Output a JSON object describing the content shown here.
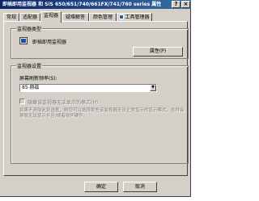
{
  "window": {
    "title": "即插即用监视器 和 SiS 650/651/740/661FX/741/760 series 属性",
    "help_label": "?",
    "close_label": "×"
  },
  "tabs": [
    {
      "label": "常规"
    },
    {
      "label": "适配器"
    },
    {
      "label": "监视器"
    },
    {
      "label": "疑难解答"
    },
    {
      "label": "颜色管理"
    },
    {
      "label": "工具管理器"
    }
  ],
  "monitor_type": {
    "group_label": "监视器类型",
    "name": "即插即用监视器",
    "properties_button": "属性(P)"
  },
  "monitor_settings": {
    "group_label": "监视器设置",
    "refresh_label": "屏幕刷新频率(S):",
    "refresh_value": "85 赫兹",
    "hide_modes_label": "隐藏该监视器无法显示的模式(H)",
    "warning_text": "如果不清除此复选框，则您可以选择那些该监视器无法正常显示的显示模式。这样会导致无法显示并且/或者损坏硬件。"
  },
  "footer": {
    "ok_label": "确定",
    "cancel_label": "取消"
  }
}
